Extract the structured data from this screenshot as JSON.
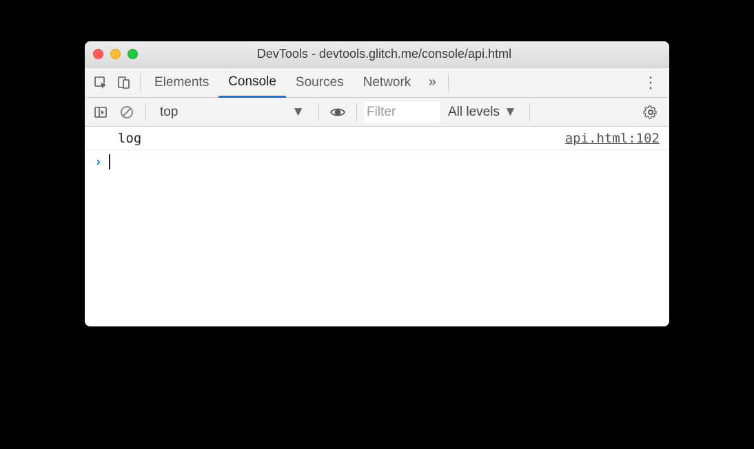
{
  "window": {
    "title": "DevTools - devtools.glitch.me/console/api.html"
  },
  "tabs": {
    "elements": "Elements",
    "console": "Console",
    "sources": "Sources",
    "network": "Network"
  },
  "toolbar": {
    "context": "top",
    "filter_placeholder": "Filter",
    "levels": "All levels"
  },
  "console": {
    "log_message": "log",
    "source_link": "api.html:102"
  }
}
